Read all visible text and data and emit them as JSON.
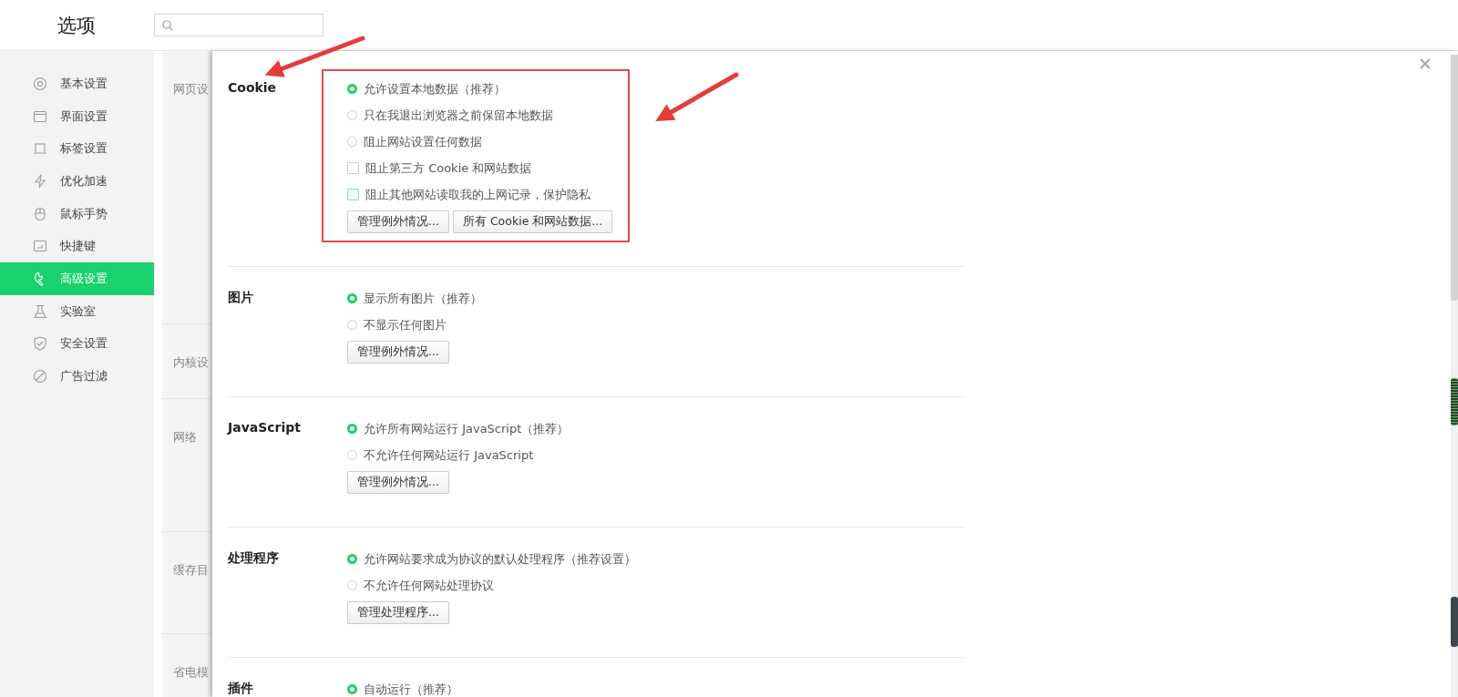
{
  "window": {
    "title": "选项"
  },
  "sidebar": {
    "items": [
      {
        "label": "基本设置",
        "selected": false
      },
      {
        "label": "界面设置",
        "selected": false
      },
      {
        "label": "标签设置",
        "selected": false
      },
      {
        "label": "优化加速",
        "selected": false
      },
      {
        "label": "鼠标手势",
        "selected": false
      },
      {
        "label": "快捷键",
        "selected": false
      },
      {
        "label": "高级设置",
        "selected": true
      },
      {
        "label": "实验室",
        "selected": false
      },
      {
        "label": "安全设置",
        "selected": false
      },
      {
        "label": "广告过滤",
        "selected": false
      }
    ]
  },
  "background_sections": [
    "网页设",
    "内核设",
    "网络",
    "缓存目",
    "省电模"
  ],
  "sections": [
    {
      "title": "Cookie",
      "highlighted": true,
      "options": [
        {
          "kind": "radio",
          "label": "允许设置本地数据（推荐）",
          "selected": true
        },
        {
          "kind": "radio",
          "label": "只在我退出浏览器之前保留本地数据",
          "selected": false
        },
        {
          "kind": "radio",
          "label": "阻止网站设置任何数据",
          "selected": false
        },
        {
          "kind": "checkbox",
          "label": "阻止第三方 Cookie 和网站数据",
          "checked": false,
          "focused": false
        },
        {
          "kind": "checkbox",
          "label": "阻止其他网站读取我的上网记录，保护隐私",
          "checked": false,
          "focused": true
        }
      ],
      "buttons": [
        "管理例外情况...",
        "所有 Cookie 和网站数据..."
      ]
    },
    {
      "title": "图片",
      "highlighted": false,
      "options": [
        {
          "kind": "radio",
          "label": "显示所有图片（推荐）",
          "selected": true
        },
        {
          "kind": "radio",
          "label": "不显示任何图片",
          "selected": false
        }
      ],
      "buttons": [
        "管理例外情况..."
      ]
    },
    {
      "title": "JavaScript",
      "highlighted": false,
      "options": [
        {
          "kind": "radio",
          "label": "允许所有网站运行 JavaScript（推荐）",
          "selected": true
        },
        {
          "kind": "radio",
          "label": "不允许任何网站运行 JavaScript",
          "selected": false
        }
      ],
      "buttons": [
        "管理例外情况..."
      ]
    },
    {
      "title": "处理程序",
      "highlighted": false,
      "options": [
        {
          "kind": "radio",
          "label": "允许网站要求成为协议的默认处理程序（推荐设置）",
          "selected": true
        },
        {
          "kind": "radio",
          "label": "不允许任何网站处理协议",
          "selected": false
        }
      ],
      "buttons": [
        "管理处理程序..."
      ]
    },
    {
      "title": "插件",
      "highlighted": false,
      "options": [
        {
          "kind": "radio",
          "label": "自动运行（推荐）",
          "selected": true
        }
      ]
    }
  ],
  "annotations": [
    {
      "kind": "arrow"
    },
    {
      "kind": "arrow"
    }
  ]
}
